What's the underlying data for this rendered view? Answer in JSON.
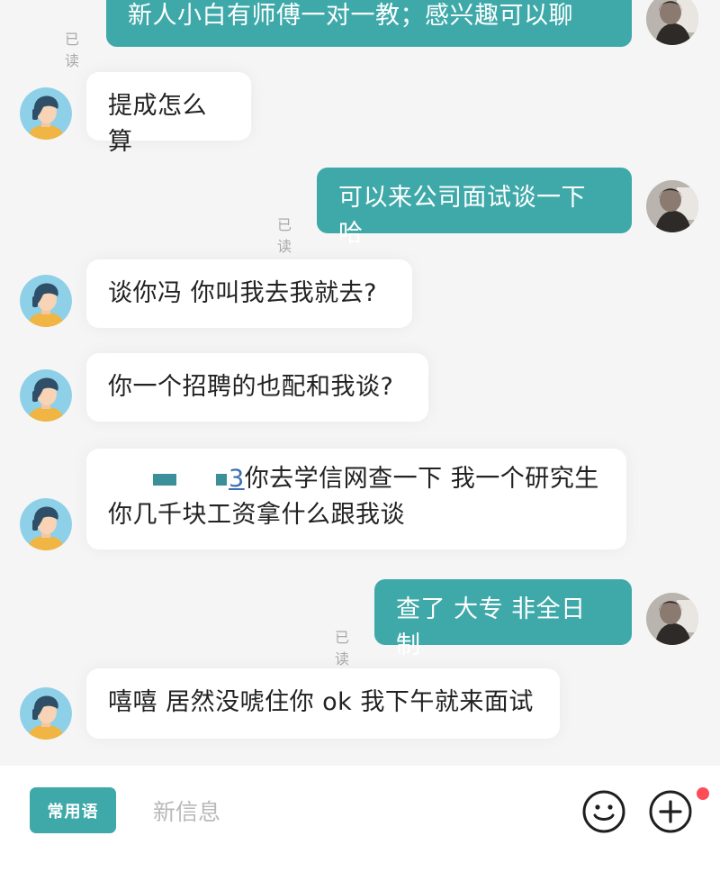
{
  "colors": {
    "accent": "#3fa9a9",
    "incoming_bubble": "#ffffff",
    "read_text": "#a9a9a9",
    "notification_dot": "#ff4d57"
  },
  "messages": [
    {
      "side": "out",
      "text": "新人小白有师傅一对一教；感兴趣可以聊",
      "read": "已读"
    },
    {
      "side": "in",
      "text": "提成怎么算"
    },
    {
      "side": "out",
      "text": "可以来公司面试谈一下哈",
      "read": "已读"
    },
    {
      "side": "in",
      "text": "谈你冯 你叫我去我就去?"
    },
    {
      "side": "in",
      "text": "你一个招聘的也配和我谈?"
    },
    {
      "side": "in",
      "line1_glyph": "3",
      "line1": "你去学信网查一下 我一个研究生",
      "line2": "你几千块工资拿什么跟我谈"
    },
    {
      "side": "out",
      "text": "查了 大专 非全日制",
      "read": "已读"
    },
    {
      "side": "in",
      "text": "嘻嘻 居然没唬住你 ok 我下午就来面试"
    }
  ],
  "input_bar": {
    "quick_phrases_label": "常用语",
    "placeholder": "新信息",
    "value": "",
    "emoji_icon": "smiley-face-icon",
    "add_icon": "plus-circle-icon"
  }
}
